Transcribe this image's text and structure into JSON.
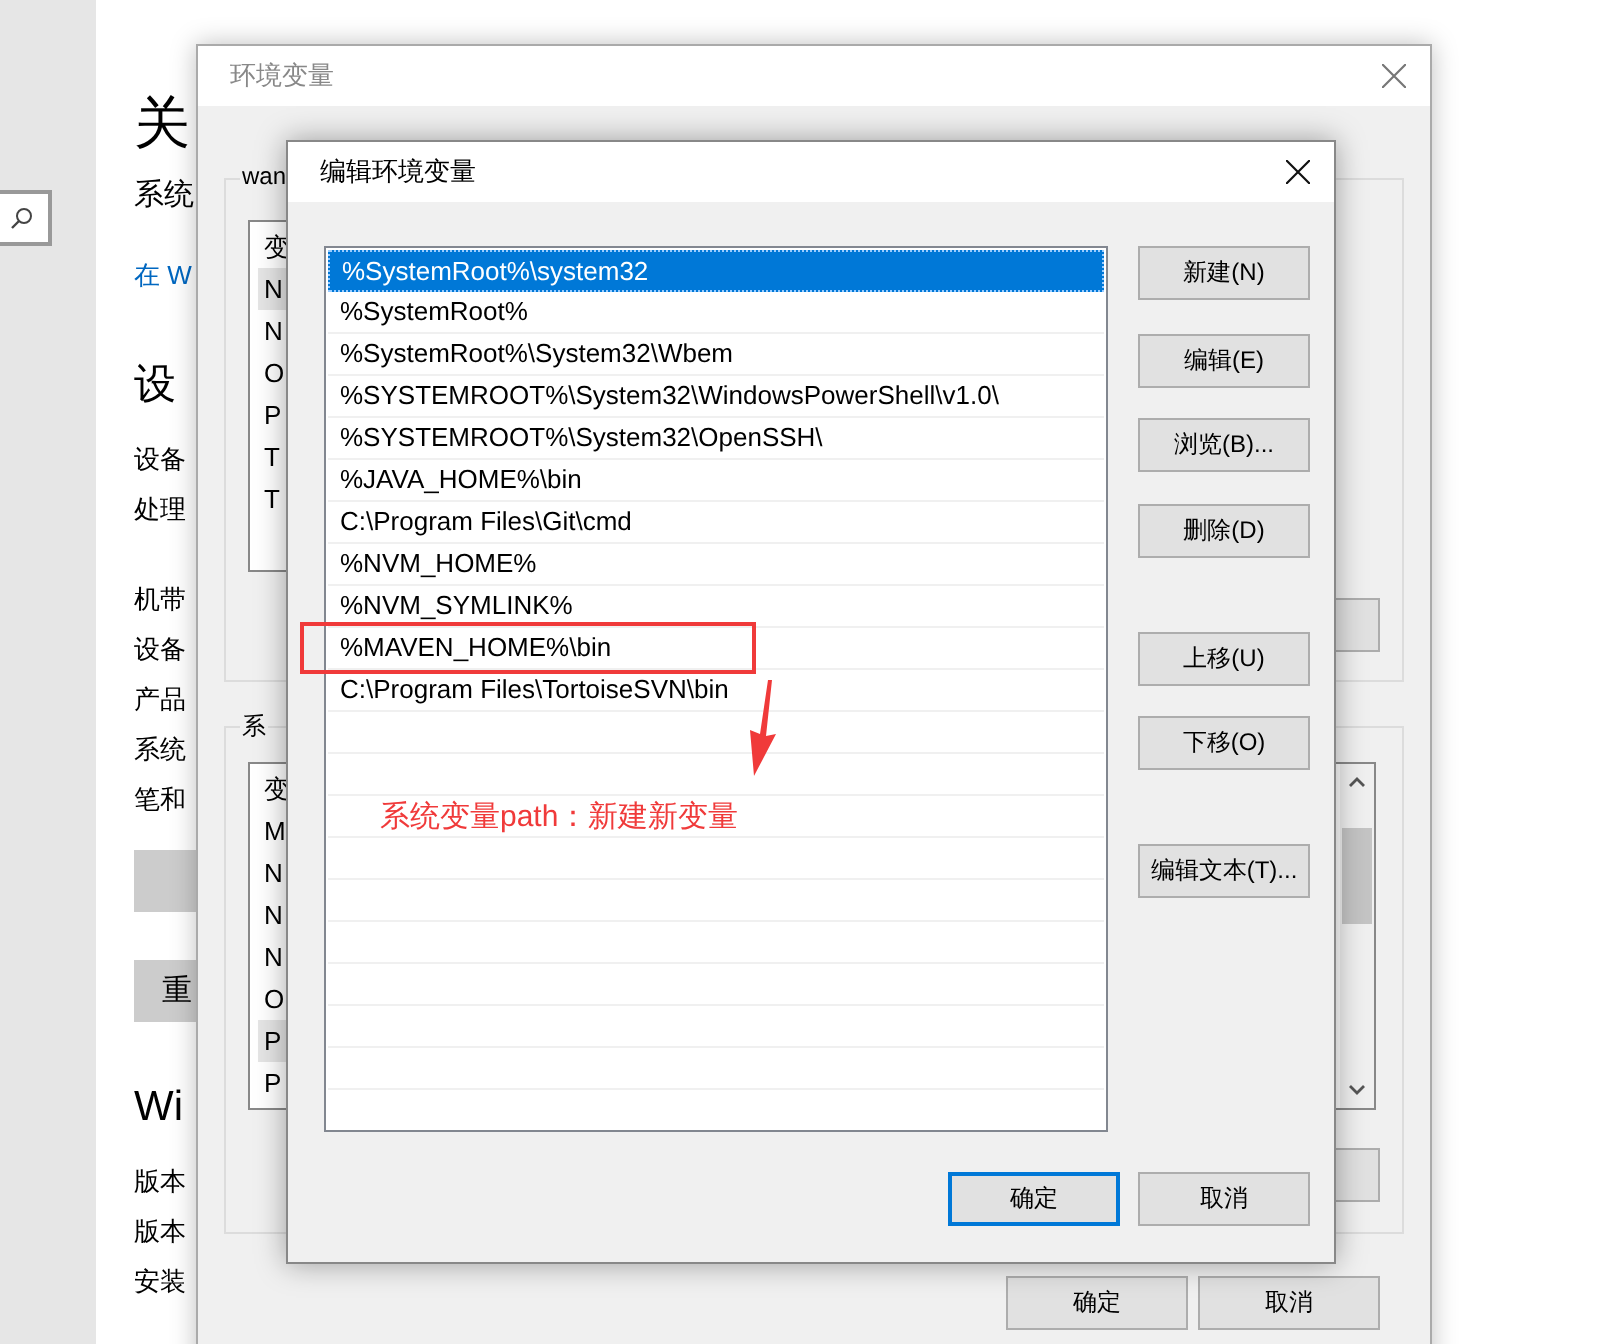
{
  "settings": {
    "lines": [
      {
        "kind": "title",
        "text": "关"
      },
      {
        "kind": "subtitle",
        "text": "系统"
      },
      {
        "kind": "link",
        "text": "在 W"
      },
      {
        "kind": "heading",
        "text": "设"
      },
      {
        "kind": "label",
        "text": "设备"
      },
      {
        "kind": "label",
        "text": "处理"
      },
      {
        "kind": "label-gap",
        "text": "机带"
      },
      {
        "kind": "label",
        "text": "设备"
      },
      {
        "kind": "label",
        "text": "产品"
      },
      {
        "kind": "label",
        "text": "系统"
      },
      {
        "kind": "label",
        "text": "笔和"
      },
      {
        "kind": "button"
      },
      {
        "kind": "button",
        "text": "重"
      },
      {
        "kind": "heading",
        "text": "Wi"
      },
      {
        "kind": "label-gap",
        "text": "版本"
      },
      {
        "kind": "label",
        "text": "版本"
      },
      {
        "kind": "label",
        "text": "安装"
      }
    ]
  },
  "env_window": {
    "title": "环境变量",
    "user_group": {
      "label": "wan",
      "column_header": "变",
      "rows": [
        {
          "text": "N",
          "selected": true
        },
        {
          "text": "N",
          "selected": false
        },
        {
          "text": "O",
          "selected": false
        },
        {
          "text": "P",
          "selected": false
        },
        {
          "text": "T",
          "selected": false
        },
        {
          "text": "T",
          "selected": false
        }
      ]
    },
    "system_group": {
      "label": "系",
      "column_header": "变",
      "rows": [
        {
          "text": "M",
          "selected": false
        },
        {
          "text": "N",
          "selected": false
        },
        {
          "text": "N",
          "selected": false
        },
        {
          "text": "N",
          "selected": false
        },
        {
          "text": "O",
          "selected": false
        },
        {
          "text": "P",
          "selected": true
        },
        {
          "text": "P",
          "selected": false
        }
      ]
    },
    "buttons": [
      "确定",
      "取消"
    ]
  },
  "edit_dialog": {
    "title": "编辑环境变量",
    "entries": [
      {
        "text": "%SystemRoot%\\system32",
        "selected": true
      },
      {
        "text": "%SystemRoot%",
        "selected": false
      },
      {
        "text": "%SystemRoot%\\System32\\Wbem",
        "selected": false
      },
      {
        "text": "%SYSTEMROOT%\\System32\\WindowsPowerShell\\v1.0\\",
        "selected": false
      },
      {
        "text": "%SYSTEMROOT%\\System32\\OpenSSH\\",
        "selected": false
      },
      {
        "text": "%JAVA_HOME%\\bin",
        "selected": false
      },
      {
        "text": "C:\\Program Files\\Git\\cmd",
        "selected": false
      },
      {
        "text": "%NVM_HOME%",
        "selected": false
      },
      {
        "text": "%NVM_SYMLINK%",
        "selected": false
      },
      {
        "text": "%MAVEN_HOME%\\bin",
        "selected": false
      },
      {
        "text": "C:\\Program Files\\TortoiseSVN\\bin",
        "selected": false
      }
    ],
    "side_buttons": [
      "新建(N)",
      "编辑(E)",
      "浏览(B)...",
      "删除(D)",
      "上移(U)",
      "下移(O)",
      "编辑文本(T)..."
    ],
    "buttons": [
      {
        "label": "确定",
        "default": true
      },
      {
        "label": "取消",
        "default": false
      }
    ]
  },
  "annotation": {
    "text": "系统变量path：新建新变量"
  }
}
